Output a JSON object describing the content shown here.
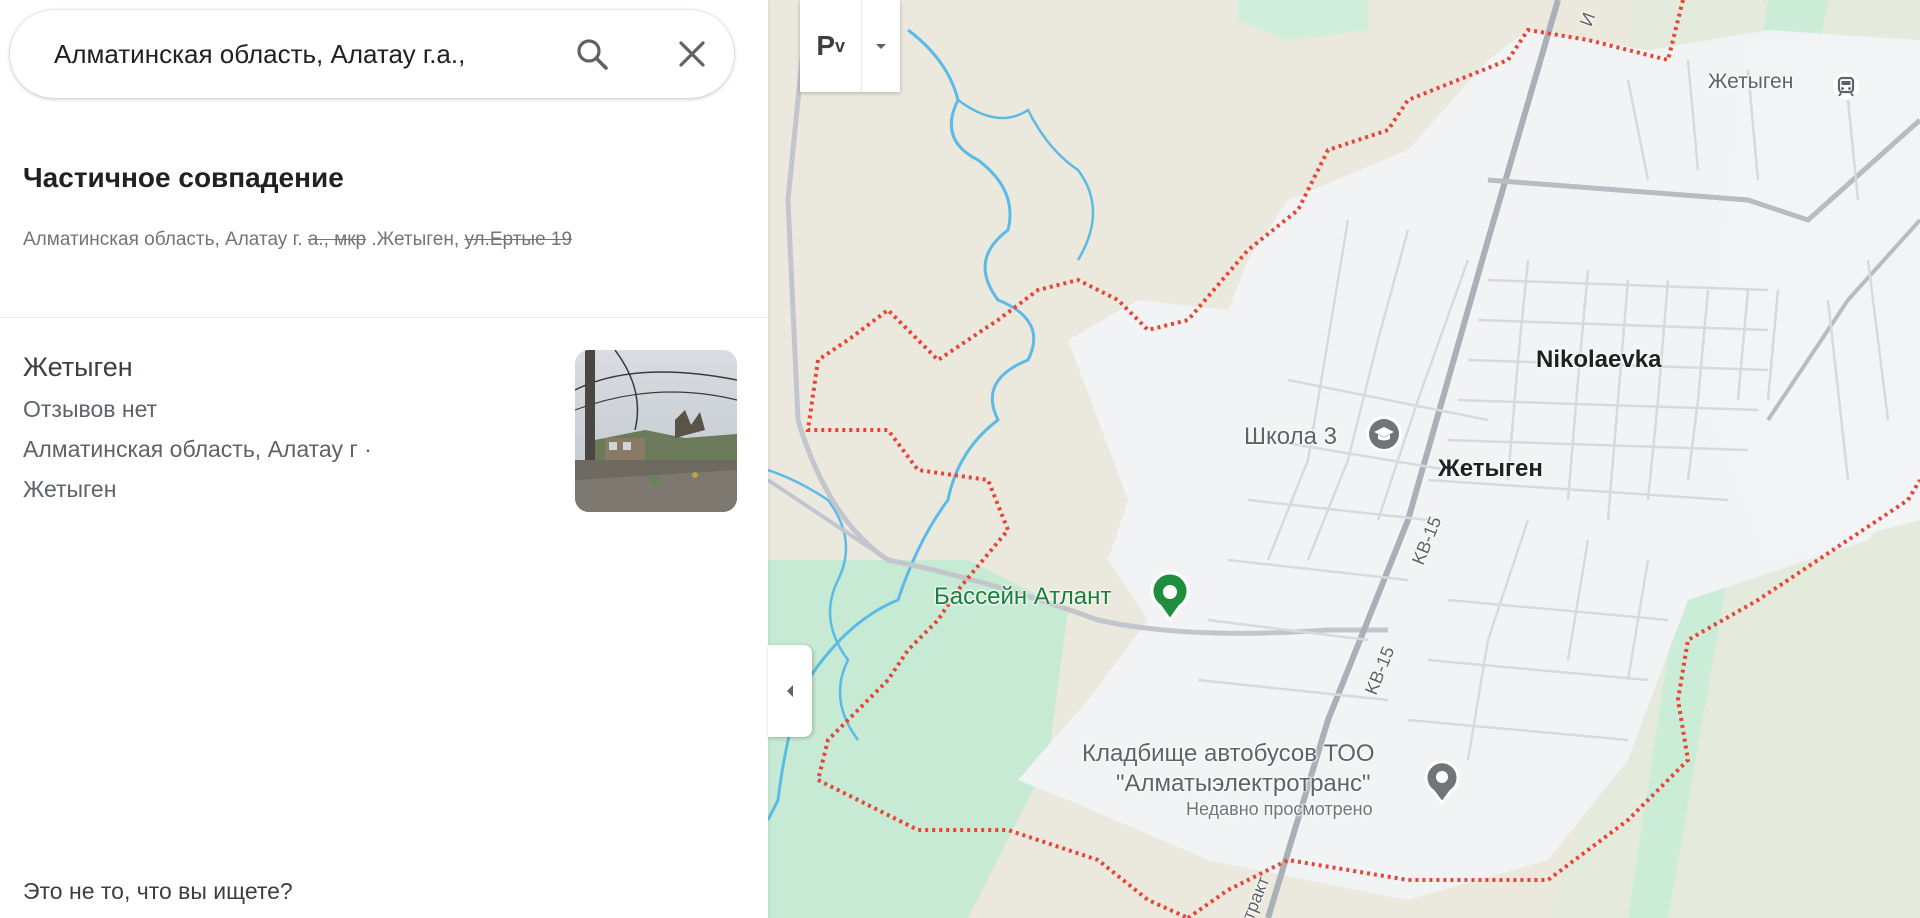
{
  "search": {
    "value": "Алматинская область, Алатау г.а.,"
  },
  "partial_match": {
    "title": "Частичное совпадение",
    "address_part1": "Алматинская область, Алатау г.",
    "address_struck1": "а., мкр",
    "address_part2": ".Жетыген,",
    "address_struck2": "ул.Ертые 19"
  },
  "result": {
    "name": "Жетыген",
    "reviews": "Отзывов нет",
    "address_line1": "Алматинская область, Алатау г ·",
    "address_line2": "Жетыген"
  },
  "footer": {
    "not_this": "Это не то, что вы ищете?"
  },
  "map_controls": {
    "layer_label": "Р"
  },
  "map": {
    "labels": {
      "zhetygen_station": "Жетыген",
      "nikolaevka": "Nikolaevka",
      "school": "Школа 3",
      "zhetygen_town": "Жетыген",
      "pool": "Бассейн Атлант",
      "cemetery_line1": "Кладбище автобусов ТОО",
      "cemetery_line2": "\"Алматыэлектротранс\"",
      "recently_viewed": "Недавно просмотрено",
      "road_kv15_a": "KB-15",
      "road_kv15_b": "KB-15",
      "road_trakt": "тракт",
      "road_top": "И"
    }
  },
  "colors": {
    "boundary": "#ea4335",
    "water": "#5bbbe6",
    "park": "#c8ebd6",
    "urban": "#f1f3f4",
    "land": "#ece9df"
  }
}
